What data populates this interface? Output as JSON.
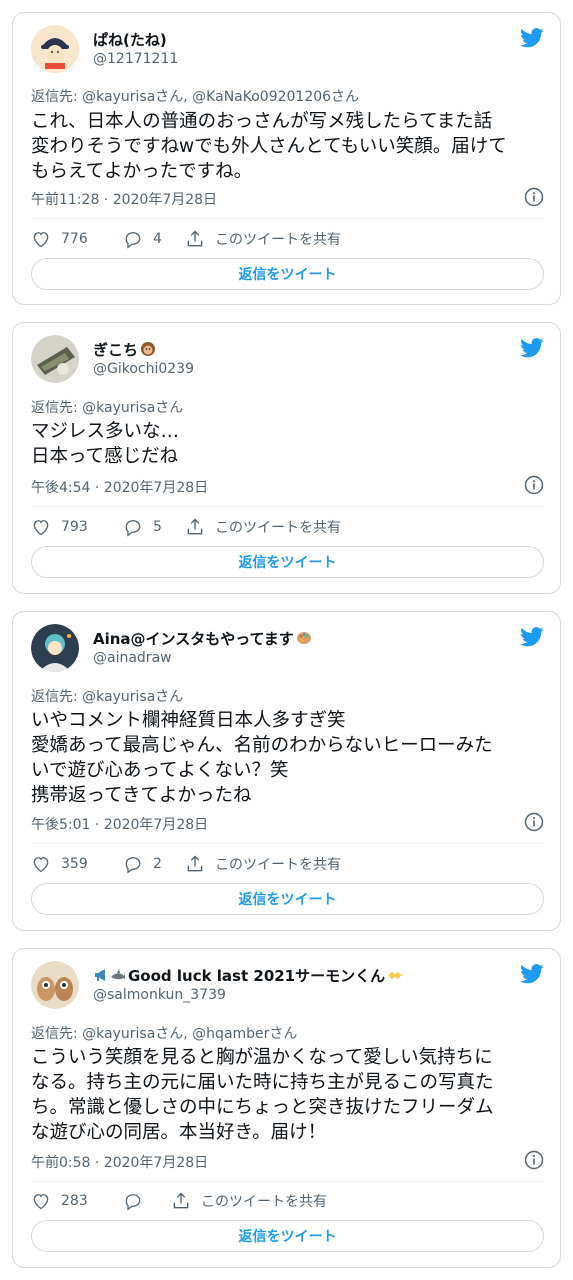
{
  "icons": {
    "brand": "twitter-bird-icon",
    "like": "heart-icon",
    "reply": "reply-bubble-icon",
    "share": "share-icon",
    "info": "info-icon"
  },
  "colors": {
    "accent": "#1d9bf0",
    "muted": "#536471",
    "border": "#cfd9de",
    "text": "#0f1419"
  },
  "tweets": [
    {
      "name": "ぱね(たね)",
      "handle": "@12171211",
      "reply_to": "返信先: @kayurisaさん, @KaNaKo09201206さん",
      "lines": [
        "これ、日本人の普通のおっさんが写メ残したらてまた話",
        "変わりそうですねwでも外人さんとてもいい笑顔。届けて",
        "もらえてよかったですね。"
      ],
      "timestamp": "午前11:28 · 2020年7月28日",
      "likes": "776",
      "replies": "4",
      "share_label": "このツイートを共有",
      "reply_button": "返信をツイート"
    },
    {
      "name": "ぎこち",
      "handle": "@Gikochi0239",
      "reply_to": "返信先: @kayurisaさん",
      "lines": [
        "マジレス多いな…",
        "日本って感じだね"
      ],
      "timestamp": "午後4:54 · 2020年7月28日",
      "likes": "793",
      "replies": "5",
      "share_label": "このツイートを共有",
      "reply_button": "返信をツイート"
    },
    {
      "name": "Aina@インスタもやってます",
      "handle": "@ainadraw",
      "reply_to": "返信先: @kayurisaさん",
      "lines": [
        "いやコメント欄神経質日本人多すぎ笑",
        "愛嬌あって最高じゃん、名前のわからないヒーローみた",
        "いで遊び心あってよくない？笑",
        "携帯返ってきてよかったね"
      ],
      "timestamp": "午後5:01 · 2020年7月28日",
      "likes": "359",
      "replies": "2",
      "share_label": "このツイートを共有",
      "reply_button": "返信をツイート"
    },
    {
      "name": "Good luck last 2021サーモンくん",
      "handle": "@salmonkun_3739",
      "reply_to": "返信先: @kayurisaさん, @hqamberさん",
      "lines": [
        "こういう笑顔を見ると胸が温かくなって愛しい気持ちに",
        "なる。持ち主の元に届いた時に持ち主が見るこの写真た",
        "ち。常識と優しさの中にちょっと突き抜けたフリーダム",
        "な遊び心の同居。本当好き。届け！"
      ],
      "timestamp": "午前0:58 · 2020年7月28日",
      "likes": "283",
      "replies": "",
      "share_label": "このツイートを共有",
      "reply_button": "返信をツイート"
    }
  ]
}
